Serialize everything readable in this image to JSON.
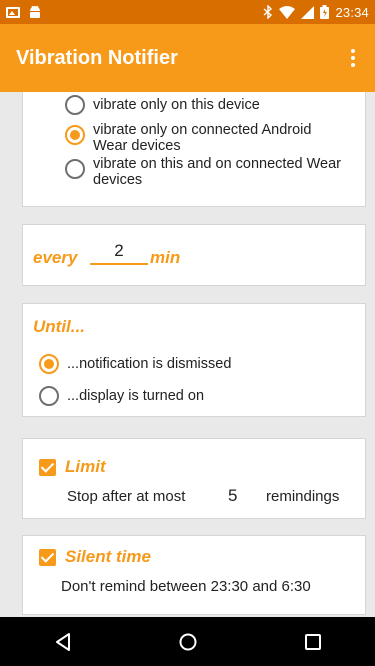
{
  "status_bar": {
    "time": "23:34",
    "left_icons": [
      "image-icon",
      "android-icon"
    ],
    "right_icons": [
      "bluetooth-icon",
      "wifi-icon",
      "signal-icon",
      "battery-icon"
    ]
  },
  "app_bar": {
    "title": "Vibration Notifier",
    "menu_icon": "more-vert-icon"
  },
  "device_card": {
    "options": [
      {
        "label": "vibrate only on this device",
        "selected": false
      },
      {
        "label": "vibrate only on connected Android Wear devices",
        "selected": true
      },
      {
        "label": "vibrate on this and on connected Wear devices",
        "selected": false
      }
    ]
  },
  "interval_card": {
    "prefix": "every",
    "value": "2",
    "suffix": "min"
  },
  "until_card": {
    "title": "Until...",
    "options": [
      {
        "label": "...notification is dismissed",
        "selected": true
      },
      {
        "label": "...display is turned on",
        "selected": false
      }
    ]
  },
  "limit_card": {
    "title": "Limit",
    "checked": true,
    "text_before": "Stop after at most",
    "value": "5",
    "text_after": "remindings"
  },
  "silent_card": {
    "title": "Silent time",
    "checked": true,
    "text": "Don't remind between 23:30 and 6:30"
  },
  "nav_bar": {
    "buttons": [
      "back-icon",
      "home-icon",
      "recents-icon"
    ]
  },
  "colors": {
    "accent": "#f79a19",
    "status_bar": "#d86e00",
    "background": "#e9e9e9"
  }
}
